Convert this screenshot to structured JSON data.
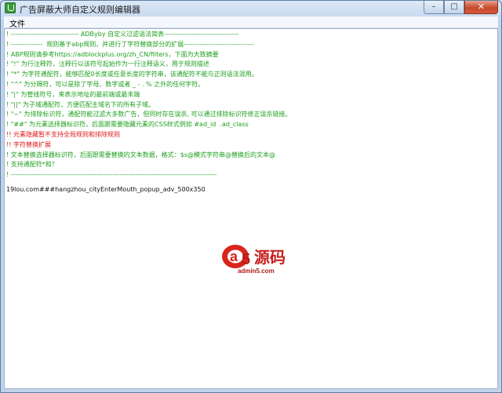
{
  "window": {
    "title": "广告屏蔽大师自定义规则编辑器",
    "buttons": {
      "minimize": "–",
      "maximize": "□",
      "close": "✕"
    }
  },
  "menu": {
    "file": "文件"
  },
  "editor": {
    "lines": [
      {
        "text": "! ------------------------------ ADByby 自定义过滤语法简表---------------------------------",
        "color": "green"
      },
      {
        "text": "! --------------  规则基于abp规则，并进行了字符替换部分的扩展-------------------------------",
        "color": "green"
      },
      {
        "text": "! ABP规则请参考https://adblockplus.org/zh_CN/filters，下面为大致摘要",
        "color": "green"
      },
      {
        "text": "! \"!\" 为行注释符，注释行以该符号起始作为一行注释语义，用于规则描述",
        "color": "green"
      },
      {
        "text": "! \"*\" 为字符通配符，能够匹配0长度或任意长度的字符串，该通配符不能与正则语法混用。",
        "color": "green"
      },
      {
        "text": "! \"^\" 为分隔符，可以是除了字母、数字或者 _ - . % 之外的任何字符。",
        "color": "green"
      },
      {
        "text": "! \"|\" 为管线符号，来表示地址的最前端或最末端",
        "color": "green"
      },
      {
        "text": "! \"||\" 为子域通配符，方便匹配主域名下的所有子域。",
        "color": "green"
      },
      {
        "text": "! \"~\" 为排除标识符，通配符能过滤大多数广告，但同时存在误杀, 可以通过排除标识符修正误杀链接。",
        "color": "green"
      },
      {
        "text": "! \"##\" 为元素选择器标识符，后面跟需要隐藏元素的CSS样式例如 #ad_id  .ad_class",
        "color": "green"
      },
      {
        "text": "!! 元素隐藏暂不支持全局规则和排除规则",
        "color": "red"
      },
      {
        "text": "!! 字符替换扩展",
        "color": "red"
      },
      {
        "text": "! 文本替换选择器标识符，后面跟需要替换的文本数据，格式：$s@模式字符串@替换后的文本@",
        "color": "green"
      },
      {
        "text": "! 支持通配符*和？",
        "color": "green"
      },
      {
        "text": "! -------------------------------------------------------------------------------------------",
        "color": "green"
      },
      {
        "text": "",
        "color": "blank"
      },
      {
        "text": "19lou.com###hangzhou_cityEnterMouth_popup_adv_500x350",
        "color": "black"
      }
    ]
  },
  "watermark": {
    "domain": "admin5.com",
    "brand_a": "a",
    "brand_num": "5",
    "brand_cn": "源码"
  }
}
